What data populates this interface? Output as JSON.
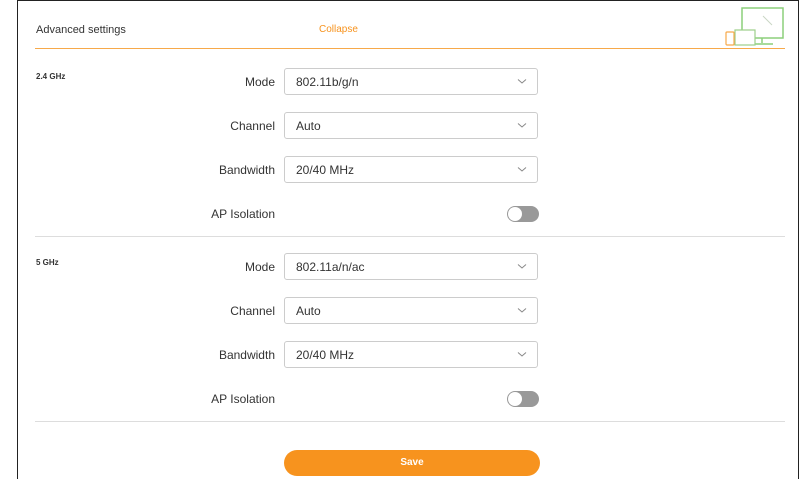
{
  "header": {
    "title": "Advanced settings",
    "collapse_label": "Collapse",
    "accent": "#f7931e"
  },
  "bands": [
    {
      "label": "2.4 GHz",
      "mode_label": "Mode",
      "mode_value": "802.11b/g/n",
      "channel_label": "Channel",
      "channel_value": "Auto",
      "bandwidth_label": "Bandwidth",
      "bandwidth_value": "20/40 MHz",
      "isolation_label": "AP Isolation",
      "isolation_on": false
    },
    {
      "label": "5 GHz",
      "mode_label": "Mode",
      "mode_value": "802.11a/n/ac",
      "channel_label": "Channel",
      "channel_value": "Auto",
      "bandwidth_label": "Bandwidth",
      "bandwidth_value": "20/40 MHz",
      "isolation_label": "AP Isolation",
      "isolation_on": false
    }
  ],
  "footer": {
    "save_label": "Save"
  },
  "icons": {
    "devices": "devices-icon",
    "chevron": "chevron-down-icon"
  }
}
